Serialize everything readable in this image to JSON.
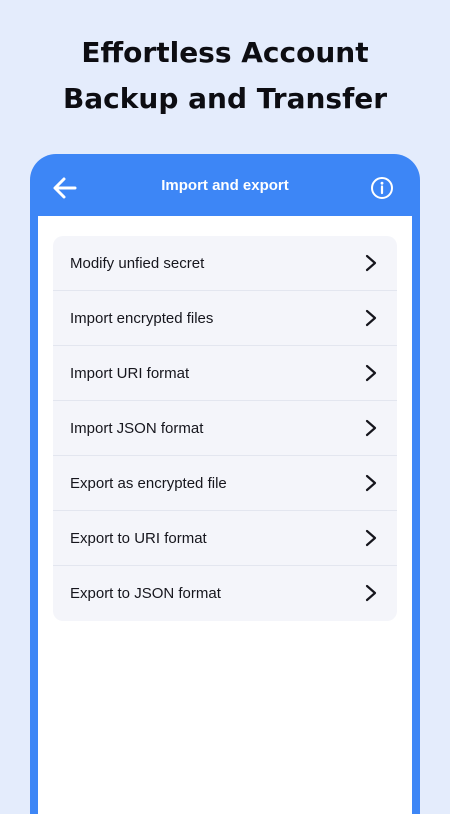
{
  "promo": {
    "headline_line1": "Effortless Account",
    "headline_line2": "Backup and Transfer"
  },
  "appbar": {
    "title": "Import and export",
    "back_icon": "arrow-left-icon",
    "info_icon": "info-circle-icon"
  },
  "menu": {
    "items": [
      {
        "label": "Modify unfied secret"
      },
      {
        "label": "Import encrypted files"
      },
      {
        "label": "Import URI format"
      },
      {
        "label": "Import JSON format"
      },
      {
        "label": "Export as encrypted file"
      },
      {
        "label": "Export to URI format"
      },
      {
        "label": "Export to JSON format"
      }
    ],
    "trailing_icon": "chevron-right-icon"
  },
  "colors": {
    "page_background": "#e4ecfc",
    "accent": "#3d86f6",
    "menu_background": "#f4f5fa",
    "text": "#16161d"
  }
}
